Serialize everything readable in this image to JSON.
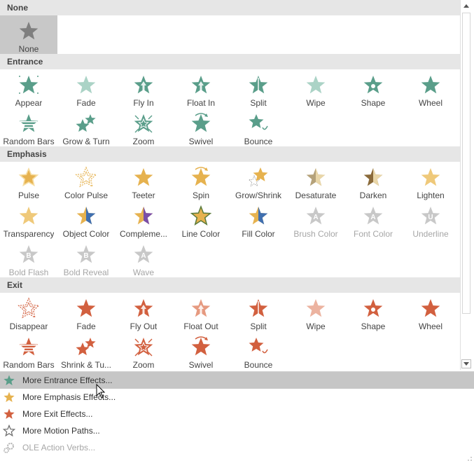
{
  "sections": [
    {
      "title": "None",
      "effects": [
        {
          "label": "None",
          "color": "#7f7f7f",
          "variant": "plain",
          "selected": true
        }
      ]
    },
    {
      "title": "Entrance",
      "effects": [
        {
          "label": "Appear",
          "color": "#5a9e8a",
          "variant": "sparkle"
        },
        {
          "label": "Fade",
          "color": "#8fc4b3",
          "variant": "fade"
        },
        {
          "label": "Fly In",
          "color": "#5a9e8a",
          "variant": "arrow-up"
        },
        {
          "label": "Float In",
          "color": "#5a9e8a",
          "variant": "arrow-up"
        },
        {
          "label": "Split",
          "color": "#5a9e8a",
          "variant": "split"
        },
        {
          "label": "Wipe",
          "color": "#8fc4b3",
          "variant": "fade"
        },
        {
          "label": "Shape",
          "color": "#5a9e8a",
          "variant": "dot"
        },
        {
          "label": "Wheel",
          "color": "#5a9e8a",
          "variant": "plain"
        },
        {
          "label": "Random Bars",
          "color": "#5a9e8a",
          "variant": "bars"
        },
        {
          "label": "Grow & Turn",
          "color": "#5a9e8a",
          "variant": "double"
        },
        {
          "label": "Zoom",
          "color": "#5a9e8a",
          "variant": "zoom"
        },
        {
          "label": "Swivel",
          "color": "#5a9e8a",
          "variant": "swivel"
        },
        {
          "label": "Bounce",
          "color": "#5a9e8a",
          "variant": "bounce"
        }
      ]
    },
    {
      "title": "Emphasis",
      "effects": [
        {
          "label": "Pulse",
          "color": "#e6b24f",
          "variant": "pulse"
        },
        {
          "label": "Color Pulse",
          "color": "#e6b24f",
          "variant": "outline-glow"
        },
        {
          "label": "Teeter",
          "color": "#e6b24f",
          "variant": "plain"
        },
        {
          "label": "Spin",
          "color": "#e6b24f",
          "variant": "swivel"
        },
        {
          "label": "Grow/Shrink",
          "color": "#e6b24f",
          "variant": "grow"
        },
        {
          "label": "Desaturate",
          "color": "#b5a27a",
          "variant": "half"
        },
        {
          "label": "Darken",
          "color": "#8a6a3a",
          "variant": "half"
        },
        {
          "label": "Lighten",
          "color": "#efc97a",
          "variant": "plain"
        },
        {
          "label": "Transparency",
          "color": "#efc97a",
          "variant": "plain"
        },
        {
          "label": "Object Color",
          "color": "#e6b24f",
          "variant": "blue-half"
        },
        {
          "label": "Compleme...",
          "color": "#e6b24f",
          "variant": "purple-half"
        },
        {
          "label": "Line Color",
          "color": "#e6b24f",
          "variant": "outlined"
        },
        {
          "label": "Fill Color",
          "color": "#e6b24f",
          "variant": "blue-half"
        },
        {
          "label": "Brush Color",
          "color": "#c8c8c8",
          "variant": "letter-A",
          "disabled": true
        },
        {
          "label": "Font Color",
          "color": "#c8c8c8",
          "variant": "letter-A",
          "disabled": true
        },
        {
          "label": "Underline",
          "color": "#c8c8c8",
          "variant": "letter-U",
          "disabled": true
        },
        {
          "label": "Bold Flash",
          "color": "#c8c8c8",
          "variant": "letter-B",
          "disabled": true
        },
        {
          "label": "Bold Reveal",
          "color": "#c8c8c8",
          "variant": "letter-B",
          "disabled": true
        },
        {
          "label": "Wave",
          "color": "#c8c8c8",
          "variant": "letter-A",
          "disabled": true
        }
      ]
    },
    {
      "title": "Exit",
      "effects": [
        {
          "label": "Disappear",
          "color": "#d2603f",
          "variant": "outline-glow"
        },
        {
          "label": "Fade",
          "color": "#d2603f",
          "variant": "plain"
        },
        {
          "label": "Fly Out",
          "color": "#d2603f",
          "variant": "arrow-up"
        },
        {
          "label": "Float Out",
          "color": "#e69a80",
          "variant": "arrow-up"
        },
        {
          "label": "Split",
          "color": "#d2603f",
          "variant": "split"
        },
        {
          "label": "Wipe",
          "color": "#e69a80",
          "variant": "fade"
        },
        {
          "label": "Shape",
          "color": "#d2603f",
          "variant": "dot"
        },
        {
          "label": "Wheel",
          "color": "#d2603f",
          "variant": "plain"
        },
        {
          "label": "Random Bars",
          "color": "#d2603f",
          "variant": "bars"
        },
        {
          "label": "Shrink & Tu...",
          "color": "#d2603f",
          "variant": "double"
        },
        {
          "label": "Zoom",
          "color": "#d2603f",
          "variant": "zoom"
        },
        {
          "label": "Swivel",
          "color": "#d2603f",
          "variant": "swivel"
        },
        {
          "label": "Bounce",
          "color": "#d2603f",
          "variant": "bounce"
        }
      ]
    }
  ],
  "menu": [
    {
      "label": "More Entrance Effects...",
      "icon": "entrance-star-icon",
      "color": "#5a9e8a",
      "highlight": true
    },
    {
      "label": "More Emphasis Effects...",
      "icon": "emphasis-star-icon",
      "color": "#e6b24f"
    },
    {
      "label": "More Exit Effects...",
      "icon": "exit-star-icon",
      "color": "#d2603f"
    },
    {
      "label": "More Motion Paths...",
      "icon": "motion-path-star-icon",
      "color": "#666666",
      "outline": true
    },
    {
      "label": "OLE Action Verbs...",
      "icon": "ole-gear-icon",
      "color": "#b0b0b0",
      "disabled": true
    }
  ]
}
